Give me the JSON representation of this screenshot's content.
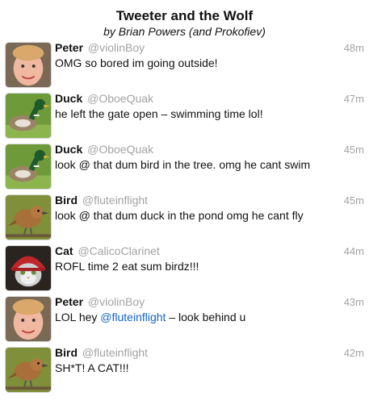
{
  "header": {
    "title": "Tweeter and the Wolf",
    "subtitle": "by Brian Powers (and Prokofiev)"
  },
  "tweets": [
    {
      "name": "Peter",
      "handle": "@violinBoy",
      "time": "48m",
      "text": "OMG so bored im going outside!",
      "avatar_icon": "boy-avatar"
    },
    {
      "name": "Duck",
      "handle": "@OboeQuak",
      "time": "47m",
      "text": "he left the gate open – swimming time lol!",
      "avatar_icon": "duck-avatar"
    },
    {
      "name": "Duck",
      "handle": "@OboeQuak",
      "time": "45m",
      "text": "look @ that dum bird in the tree. omg he cant swim",
      "avatar_icon": "duck-avatar"
    },
    {
      "name": "Bird",
      "handle": "@fluteinflight",
      "time": "45m",
      "text": "look @ that dum duck in the pond omg he cant fly",
      "avatar_icon": "bird-avatar"
    },
    {
      "name": "Cat",
      "handle": "@CalicoClarinet",
      "time": "44m",
      "text": "ROFL time 2 eat sum birdz!!!",
      "avatar_icon": "cat-avatar"
    },
    {
      "name": "Peter",
      "handle": "@violinBoy",
      "time": "43m",
      "text_before": "LOL hey ",
      "mention": "@fluteinflight",
      "text_after": " – look behind u",
      "avatar_icon": "boy-avatar"
    },
    {
      "name": "Bird",
      "handle": "@fluteinflight",
      "time": "42m",
      "text": "SH*T! A CAT!!!",
      "avatar_icon": "bird-avatar"
    }
  ],
  "colors": {
    "handle": "#a3a3a3",
    "mention": "#1565c0"
  }
}
